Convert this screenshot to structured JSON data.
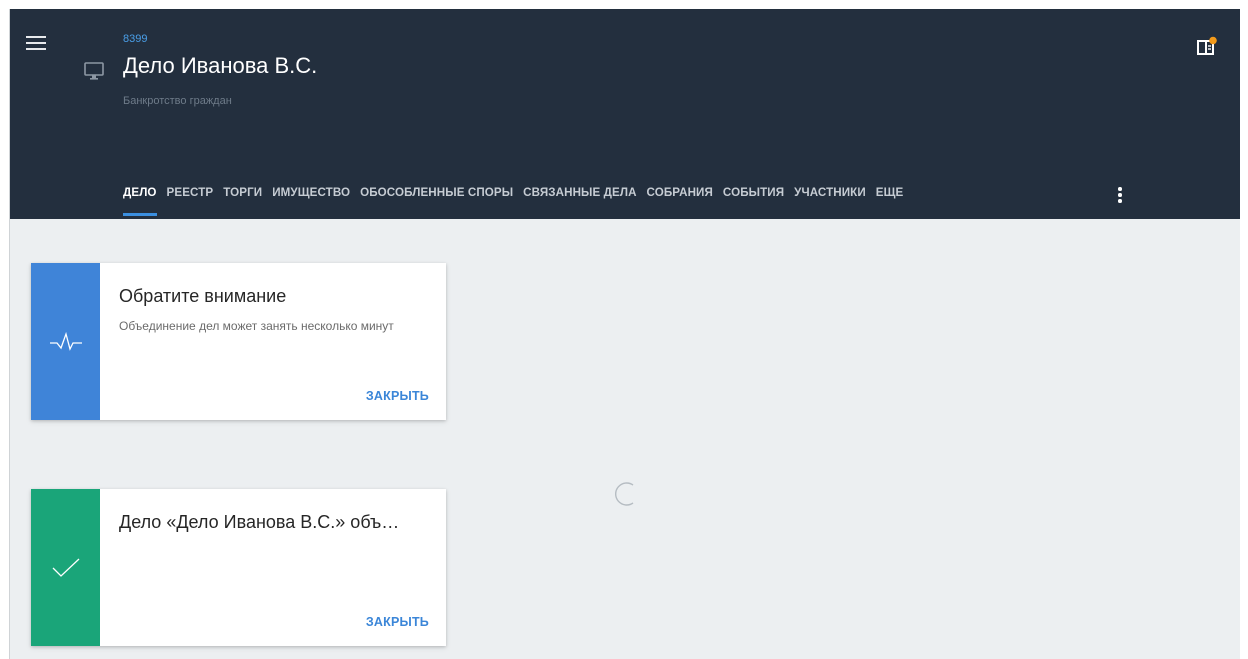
{
  "header": {
    "case_number": "8399",
    "case_title": "Дело Иванова В.С.",
    "case_subtitle": "Банкротство граждан"
  },
  "tabs": [
    {
      "label": "ДЕЛО",
      "active": true
    },
    {
      "label": "РЕЕСТР"
    },
    {
      "label": "ТОРГИ"
    },
    {
      "label": "ИМУЩЕСТВО"
    },
    {
      "label": "ОБОСОБЛЕННЫЕ СПОРЫ"
    },
    {
      "label": "СВЯЗАННЫЕ ДЕЛА"
    },
    {
      "label": "СОБРАНИЯ"
    },
    {
      "label": "СОБЫТИЯ"
    },
    {
      "label": "УЧАСТНИКИ"
    },
    {
      "label": "ЕЩЕ"
    }
  ],
  "notifications": [
    {
      "title": "Обратите внимание",
      "text": "Объединение дел может занять несколько минут",
      "close_label": "ЗАКРЫТЬ",
      "icon": "pulse-icon",
      "color": "#3f84d8"
    },
    {
      "title": "Дело «Дело Иванова В.С.» объ…",
      "close_label": "ЗАКРЫТЬ",
      "icon": "check-icon",
      "color": "#1aa579"
    }
  ],
  "colors": {
    "header_bg": "#232f3e",
    "accent": "#3b8fe0",
    "content_bg": "#eceff1",
    "badge": "#f29a1a"
  },
  "icons": {
    "menu": "hamburger-menu-icon",
    "case_type": "monitor-icon",
    "header_action": "sidebar-panel-icon",
    "overflow": "kebab-menu-icon",
    "loading": "loading-spinner-icon"
  }
}
